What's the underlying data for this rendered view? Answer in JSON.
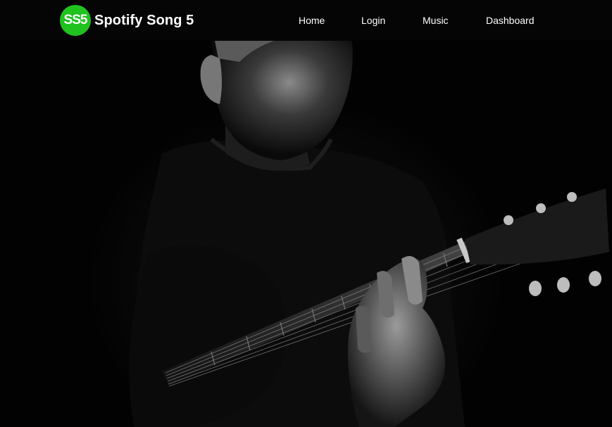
{
  "brand": {
    "logo_text": "SS5",
    "name": "Spotify Song 5",
    "accent": "#1fc21f"
  },
  "nav": {
    "items": [
      {
        "label": "Home"
      },
      {
        "label": "Login"
      },
      {
        "label": "Music"
      },
      {
        "label": "Dashboard"
      }
    ]
  },
  "hero": {
    "image_subject": "guitarist-photo"
  }
}
